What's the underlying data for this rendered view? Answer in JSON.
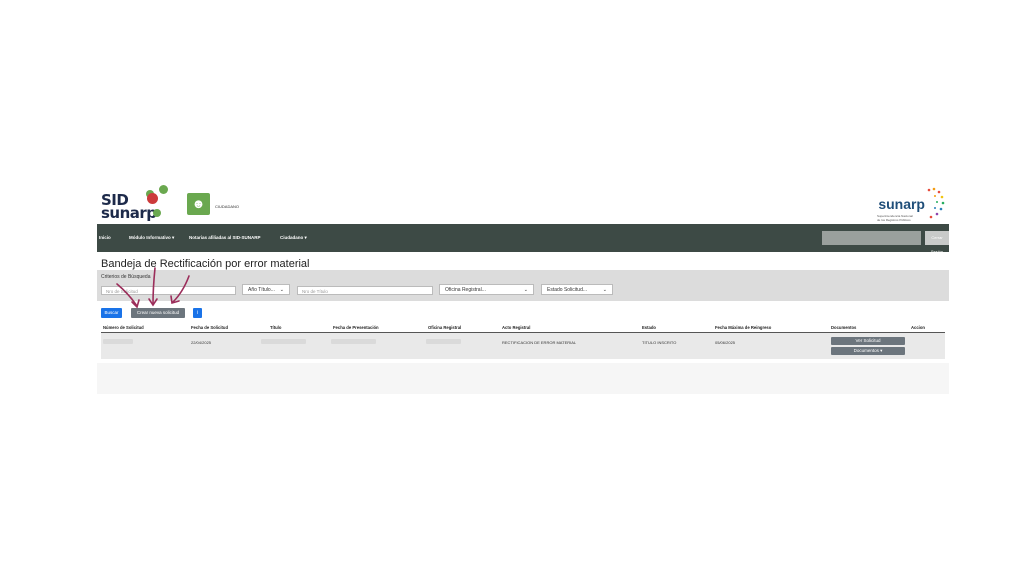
{
  "header": {
    "logo_top": "SID",
    "logo_bottom": "sunarp",
    "profile_label": "CIUDADANO",
    "brand": "sunarp",
    "brand_sub": "Superintendencia Nacional de los Registros Públicos"
  },
  "nav": {
    "items": [
      "Inicio",
      "Módulo Informativo",
      "Notarias afiliadas al SID-SUNARP",
      "Ciudadano"
    ],
    "search_button": "Cerrar Sesión"
  },
  "page": {
    "title": "Bandeja de Rectificación por error material",
    "criteria_label": "Criterios de Búsqueda",
    "filters": {
      "nro_solicitud_placeholder": "Nro de Solicitud",
      "anio_titulo": "Año Título...",
      "nro_titulo_placeholder": "Nro de Título",
      "oficina_registral": "Oficina Registral...",
      "estado_solicitud": "Estado Solicitud..."
    },
    "buttons": {
      "buscar": "Buscar",
      "crear": "Crear nueva solicitud",
      "info": "i"
    }
  },
  "table": {
    "headers": [
      "Número de Solicitud",
      "Fecha de Solicitud",
      "Título",
      "Fecha de Presentación",
      "Oficina Registral",
      "Acto Registral",
      "Estado",
      "Fecha Máxima de Reingreso",
      "Documentos",
      "Accion"
    ],
    "rows": [
      {
        "fecha_solicitud": "22/04/2025",
        "acto_registral": "RECTIFICACION DE ERROR MATERIAL",
        "estado": "TITULO INSCRITO",
        "fecha_maxima": "05/06/2025",
        "ver_label": "Ver Solicitud",
        "docs_label": "Documentos"
      }
    ]
  },
  "colors": {
    "nav_bg": "#3d4a45",
    "primary": "#1a73e8",
    "secondary": "#6c757d",
    "annotation": "#9b2d5a"
  }
}
